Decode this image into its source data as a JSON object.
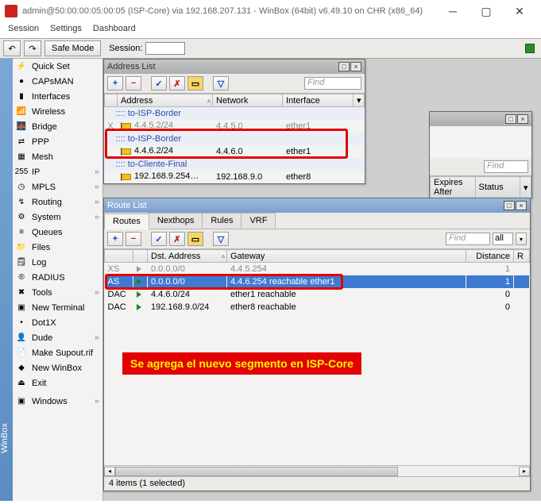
{
  "window": {
    "title": "admin@50:00:00:05:00:05 (ISP-Core) via 192.168.207.131 - WinBox (64bit) v6.49.10 on CHR (x86_64)"
  },
  "menubar": [
    "Session",
    "Settings",
    "Dashboard"
  ],
  "toolbar": {
    "safe_mode": "Safe Mode",
    "session_label": "Session:"
  },
  "brand": "WinBox",
  "sidebar": {
    "items": [
      {
        "icon": "⚡",
        "label": "Quick Set"
      },
      {
        "icon": "●",
        "label": "CAPsMAN"
      },
      {
        "icon": "▮",
        "label": "Interfaces"
      },
      {
        "icon": "📶",
        "label": "Wireless"
      },
      {
        "icon": "🌉",
        "label": "Bridge"
      },
      {
        "icon": "⇄",
        "label": "PPP"
      },
      {
        "icon": "▦",
        "label": "Mesh"
      },
      {
        "icon": "255",
        "label": "IP",
        "expand": true
      },
      {
        "icon": "◷",
        "label": "MPLS",
        "expand": true
      },
      {
        "icon": "↯",
        "label": "Routing",
        "expand": true
      },
      {
        "icon": "⚙",
        "label": "System",
        "expand": true
      },
      {
        "icon": "≡",
        "label": "Queues"
      },
      {
        "icon": "📁",
        "label": "Files"
      },
      {
        "icon": "🗒",
        "label": "Log"
      },
      {
        "icon": "®",
        "label": "RADIUS"
      },
      {
        "icon": "✖",
        "label": "Tools",
        "expand": true
      },
      {
        "icon": "▣",
        "label": "New Terminal"
      },
      {
        "icon": "•",
        "label": "Dot1X"
      },
      {
        "icon": "👤",
        "label": "Dude",
        "expand": true
      },
      {
        "icon": "📄",
        "label": "Make Supout.rif"
      },
      {
        "icon": "◆",
        "label": "New WinBox"
      },
      {
        "icon": "⏏",
        "label": "Exit"
      }
    ],
    "windows_item": {
      "icon": "▣",
      "label": "Windows",
      "expand": true
    }
  },
  "address_list": {
    "title": "Address List",
    "find_placeholder": "Find",
    "columns": [
      "Address",
      "Network",
      "Interface"
    ],
    "rows": [
      {
        "group": ":::: to-ISP-Border"
      },
      {
        "flag": "X",
        "dim": true,
        "addr": "4.4.5.2/24",
        "net": "4.4.5.0",
        "iface": "ether1"
      },
      {
        "group": ":::: to-ISP-Border"
      },
      {
        "flag": "",
        "addr": "4.4.6.2/24",
        "net": "4.4.6.0",
        "iface": "ether1"
      },
      {
        "group": ":::: to-Cliente-Final"
      },
      {
        "flag": "",
        "addr": "192.168.9.254…",
        "net": "192.168.9.0",
        "iface": "ether8"
      }
    ]
  },
  "partial_window": {
    "find_placeholder": "Find",
    "columns": [
      "Expires After",
      "Status"
    ]
  },
  "route_list": {
    "title": "Route List",
    "tabs": [
      "Routes",
      "Nexthops",
      "Rules",
      "VRF"
    ],
    "active_tab": 0,
    "find_placeholder": "Find",
    "all_label": "all",
    "columns": [
      "",
      "",
      "Dst. Address",
      "Gateway",
      "Distance",
      "R"
    ],
    "rows": [
      {
        "flag": "XS",
        "dim": true,
        "dst": "0.0.0.0/0",
        "gw": "4.4.5.254",
        "dist": "1",
        "r": ""
      },
      {
        "flag": "AS",
        "sel": true,
        "dst": "0.0.0.0/0",
        "gw": "4.4.6.254 reachable ether1",
        "dist": "1",
        "r": ""
      },
      {
        "flag": "DAC",
        "dst": "4.4.6.0/24",
        "gw": "ether1 reachable",
        "dist": "0",
        "r": ""
      },
      {
        "flag": "DAC",
        "dst": "192.168.9.0/24",
        "gw": "ether8 reachable",
        "dist": "0",
        "r": ""
      }
    ],
    "status": "4 items (1 selected)"
  },
  "annotation": "Se agrega el nuevo segmento en ISP-Core"
}
